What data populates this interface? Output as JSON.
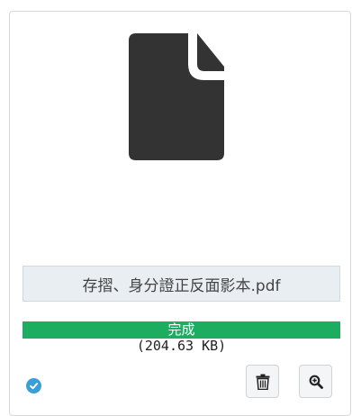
{
  "file": {
    "icon": "file-icon",
    "name": "存摺、身分證正反面影本.pdf",
    "size": "(204.63 KB)"
  },
  "upload": {
    "status_label": "完成",
    "progress": 1.0,
    "status_icon": "check-circle-icon",
    "status_color": "#3a9ed8",
    "progress_color": "#1cad61"
  },
  "actions": {
    "delete_icon": "trash-icon",
    "zoom_icon": "zoom-in-icon"
  }
}
